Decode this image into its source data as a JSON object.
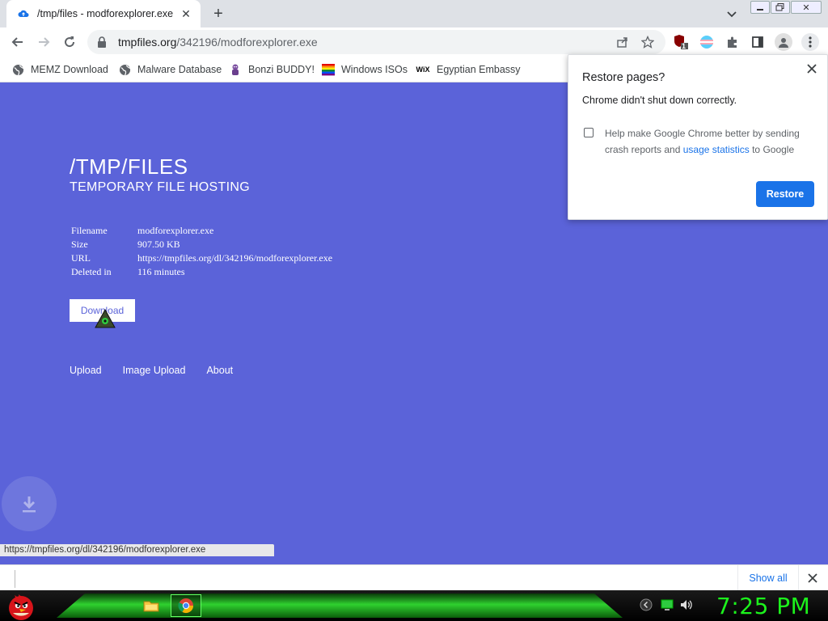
{
  "browser": {
    "tab_title": "/tmp/files - modforexplorer.exe",
    "url_host": "tmpfiles.org",
    "url_path": "/342196/modforexplorer.exe",
    "extension_badge": "1"
  },
  "bookmarks": [
    {
      "label": "MEMZ Download",
      "icon": "globe-icon"
    },
    {
      "label": "Malware Database",
      "icon": "globe-icon"
    },
    {
      "label": "Bonzi BUDDY!",
      "icon": "bonzi-icon"
    },
    {
      "label": "Windows ISOs",
      "icon": "rainbow-flag-icon"
    },
    {
      "label": "Egyptian Embassy",
      "icon": "wix-icon"
    }
  ],
  "page": {
    "title": "/TMP/FILES",
    "subtitle": "TEMPORARY FILE HOSTING",
    "file_info": [
      {
        "key": "Filename",
        "value": "modforexplorer.exe"
      },
      {
        "key": "Size",
        "value": "907.50 KB"
      },
      {
        "key": "URL",
        "value": "https://tmpfiles.org/dl/342196/modforexplorer.exe"
      },
      {
        "key": "Deleted in",
        "value": "116 minutes"
      }
    ],
    "download_label": "Download",
    "footer_links": [
      "Upload",
      "Image Upload",
      "About"
    ],
    "status_url": "https://tmpfiles.org/dl/342196/modforexplorer.exe",
    "bg_color": "#5b63d9"
  },
  "popup": {
    "title": "Restore pages?",
    "message": "Chrome didn't shut down correctly.",
    "checkbox_text_before": "Help make Google Chrome better by sending crash reports and ",
    "checkbox_link": "usage statistics",
    "checkbox_text_after": " to Google",
    "restore_label": "Restore"
  },
  "shelf": {
    "show_all_label": "Show all"
  },
  "taskbar": {
    "clock": "7:25 PM"
  }
}
